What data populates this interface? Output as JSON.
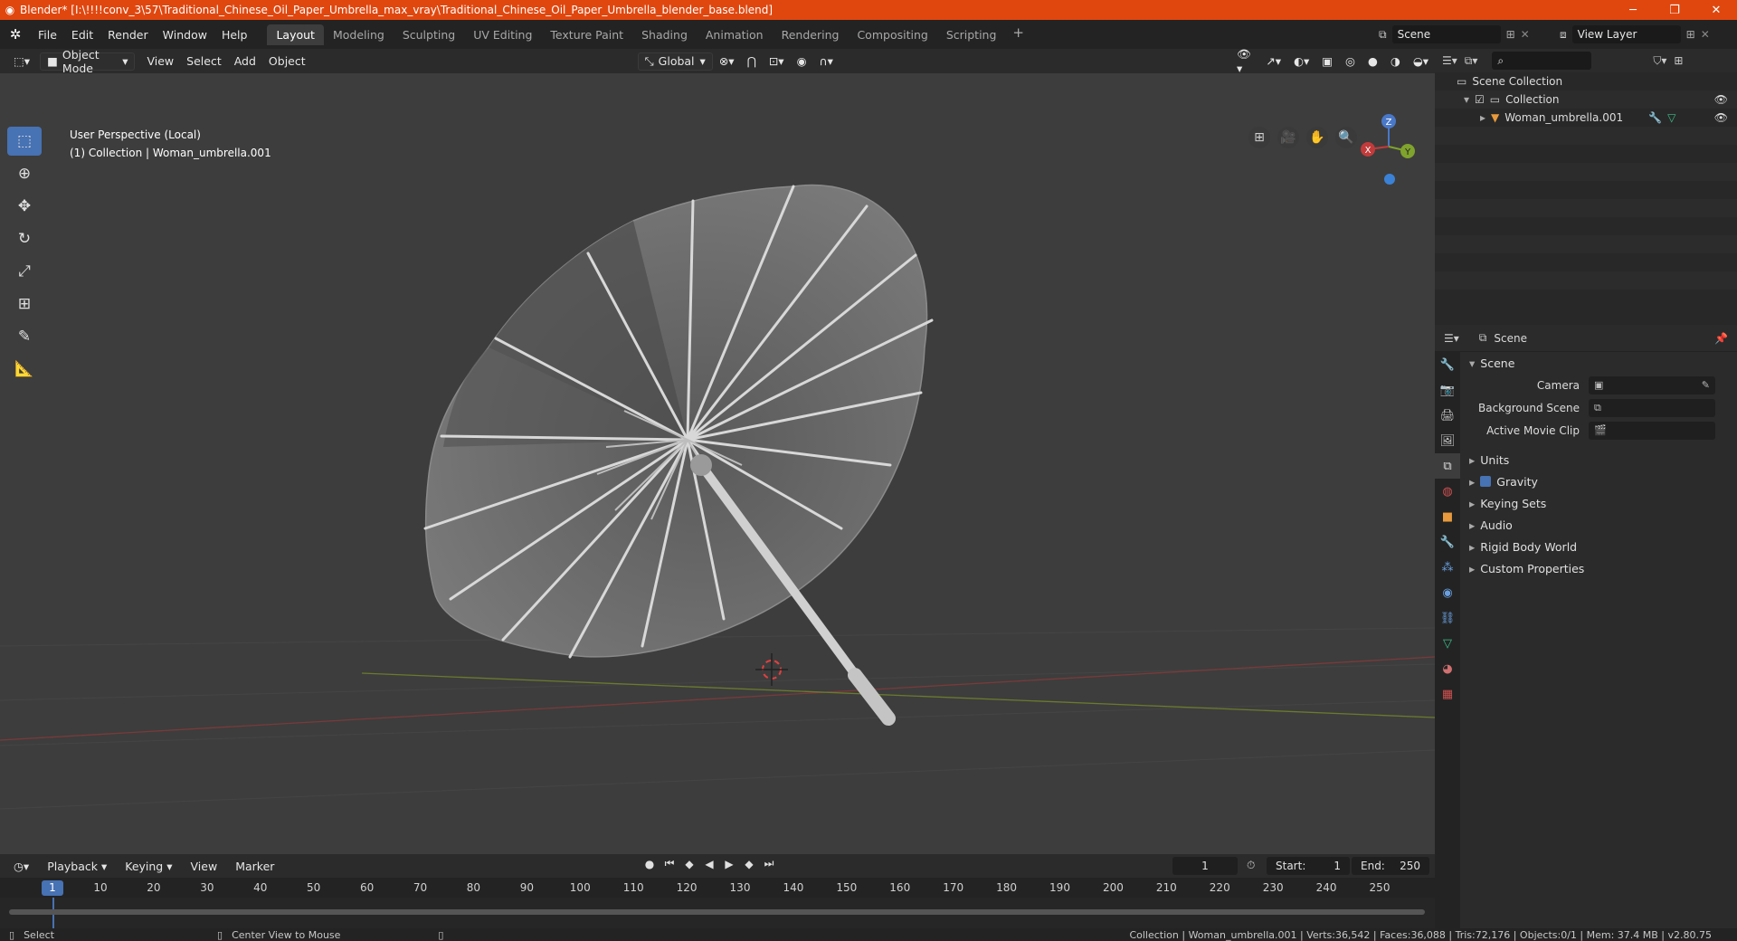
{
  "window": {
    "title": "Blender* [I:\\!!!!conv_3\\57\\Traditional_Chinese_Oil_Paper_Umbrella_max_vray\\Traditional_Chinese_Oil_Paper_Umbrella_blender_base.blend]",
    "min": "─",
    "max": "❐",
    "close": "✕"
  },
  "menu": [
    "File",
    "Edit",
    "Render",
    "Window",
    "Help"
  ],
  "workspaces": [
    "Layout",
    "Modeling",
    "Sculpting",
    "UV Editing",
    "Texture Paint",
    "Shading",
    "Animation",
    "Rendering",
    "Compositing",
    "Scripting"
  ],
  "workspace_add": "+",
  "scene_name": "Scene",
  "view_layer": "View Layer",
  "viewport": {
    "mode": "Object Mode",
    "menus": [
      "View",
      "Select",
      "Add",
      "Object"
    ],
    "transform": "Global",
    "info_line1": "User Perspective (Local)",
    "info_line2": "(1) Collection | Woman_umbrella.001",
    "gizmo": {
      "x": "X",
      "y": "Y",
      "z": "Z"
    }
  },
  "outliner": {
    "root": "Scene Collection",
    "collection": "Collection",
    "object": "Woman_umbrella.001"
  },
  "properties": {
    "context": "Scene",
    "section": "Scene",
    "camera_label": "Camera",
    "bg_scene_label": "Background Scene",
    "movie_clip_label": "Active Movie Clip",
    "panels": [
      "Units",
      "Gravity",
      "Keying Sets",
      "Audio",
      "Rigid Body World",
      "Custom Properties"
    ]
  },
  "timeline": {
    "menus": [
      "Playback",
      "Keying",
      "View",
      "Marker"
    ],
    "current_frame": "1",
    "start_label": "Start:",
    "start": "1",
    "end_label": "End:",
    "end": "250",
    "ticks": [
      "1",
      "10",
      "20",
      "30",
      "40",
      "50",
      "60",
      "70",
      "80",
      "90",
      "100",
      "110",
      "120",
      "130",
      "140",
      "150",
      "160",
      "170",
      "180",
      "190",
      "200",
      "210",
      "220",
      "230",
      "240",
      "250"
    ]
  },
  "status": {
    "left": "Select",
    "middle": "Center View to Mouse",
    "right": "Collection | Woman_umbrella.001 | Verts:36,542 | Faces:36,088 | Tris:72,176 | Objects:0/1 | Mem: 37.4 MB | v2.80.75"
  }
}
